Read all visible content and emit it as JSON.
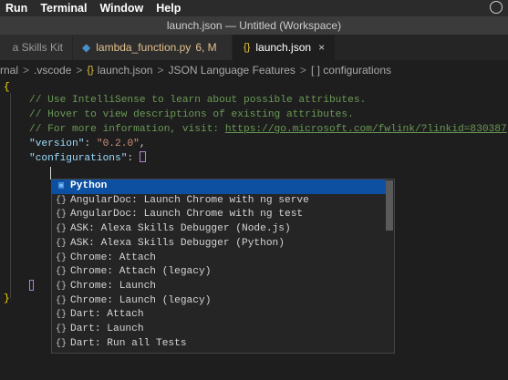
{
  "menubar": {
    "items": [
      "Run",
      "Terminal",
      "Window",
      "Help"
    ]
  },
  "titlebar": {
    "title": "launch.json — Untitled (Workspace)"
  },
  "tabs": [
    {
      "label": "a Skills Kit"
    },
    {
      "label": "lambda_function.py",
      "badge": "6, M"
    },
    {
      "label": "launch.json",
      "close": "×"
    }
  ],
  "breadcrumb": {
    "items": [
      "rnal",
      ".vscode",
      "launch.json",
      "JSON Language Features",
      "[ ] configurations"
    ],
    "separator": ">"
  },
  "code": {
    "open_brace": "{",
    "comment1": "// Use IntelliSense to learn about possible attributes.",
    "comment2": "// Hover to view descriptions of existing attributes.",
    "comment3_prefix": "// For more information, visit: ",
    "comment3_link": "https://go.microsoft.com/fwlink/?linkid=830387",
    "version_key": "\"version\"",
    "version_value": "\"0.2.0\"",
    "configurations_key": "\"configurations\"",
    "close_brace": "}"
  },
  "suggest": {
    "items": [
      {
        "icon": "snippet-icon",
        "label": "Python",
        "selected": true
      },
      {
        "icon": "braces-icon",
        "label": "AngularDoc: Launch Chrome with ng serve"
      },
      {
        "icon": "braces-icon",
        "label": "AngularDoc: Launch Chrome with ng test"
      },
      {
        "icon": "braces-icon",
        "label": "ASK: Alexa Skills Debugger (Node.js)"
      },
      {
        "icon": "braces-icon",
        "label": "ASK: Alexa Skills Debugger (Python)"
      },
      {
        "icon": "braces-icon",
        "label": "Chrome: Attach"
      },
      {
        "icon": "braces-icon",
        "label": "Chrome: Attach (legacy)"
      },
      {
        "icon": "braces-icon",
        "label": "Chrome: Launch"
      },
      {
        "icon": "braces-icon",
        "label": "Chrome: Launch (legacy)"
      },
      {
        "icon": "braces-icon",
        "label": "Dart: Attach"
      },
      {
        "icon": "braces-icon",
        "label": "Dart: Launch"
      },
      {
        "icon": "braces-icon",
        "label": "Dart: Run all Tests"
      }
    ]
  },
  "colors": {
    "selection": "#0d4fa0",
    "comment": "#6a9955",
    "string": "#ce9178",
    "key": "#9cdcfe",
    "bracket": "#ffd700"
  }
}
